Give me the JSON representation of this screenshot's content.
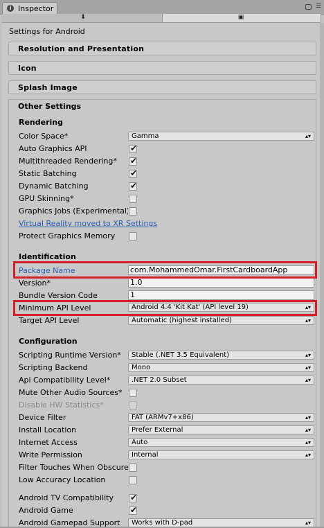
{
  "window": {
    "tab_label": "Inspector",
    "tab_icon": "info-icon"
  },
  "platform_tabs": {
    "icons": [
      "download-icon",
      "android-icon"
    ],
    "selected": "android-icon"
  },
  "subtitle": "Settings for Android",
  "sections": {
    "resolution": "Resolution and Presentation",
    "icon": "Icon",
    "splash": "Splash Image",
    "other": "Other Settings"
  },
  "rendering": {
    "header": "Rendering",
    "color_space": {
      "label": "Color Space*",
      "value": "Gamma"
    },
    "auto_graphics_api": {
      "label": "Auto Graphics API",
      "checked": true
    },
    "multithreaded": {
      "label": "Multithreaded Rendering*",
      "checked": true
    },
    "static_batching": {
      "label": "Static Batching",
      "checked": true
    },
    "dynamic_batching": {
      "label": "Dynamic Batching",
      "checked": true
    },
    "gpu_skinning": {
      "label": "GPU Skinning*",
      "checked": false
    },
    "graphics_jobs": {
      "label": "Graphics Jobs (Experimental)",
      "checked": false
    },
    "vr_link": "Virtual Reality moved to XR Settings",
    "protect_memory": {
      "label": "Protect Graphics Memory",
      "checked": false
    }
  },
  "identification": {
    "header": "Identification",
    "package_name": {
      "label": "Package Name",
      "value": "com.MohammedOmar.FirstCardboardApp"
    },
    "version": {
      "label": "Version*",
      "value": "1.0"
    },
    "bundle_version_code": {
      "label": "Bundle Version Code",
      "value": "1"
    },
    "min_api": {
      "label": "Minimum API Level",
      "value": "Android 4.4 'Kit Kat' (API level 19)"
    },
    "target_api": {
      "label": "Target API Level",
      "value": "Automatic (highest installed)"
    }
  },
  "configuration": {
    "header": "Configuration",
    "scripting_runtime": {
      "label": "Scripting Runtime Version*",
      "value": "Stable (.NET 3.5 Equivalent)"
    },
    "scripting_backend": {
      "label": "Scripting Backend",
      "value": "Mono"
    },
    "api_compat": {
      "label": "Api Compatibility Level*",
      "value": ".NET 2.0 Subset"
    },
    "mute_audio": {
      "label": "Mute Other Audio Sources*",
      "checked": false
    },
    "disable_hw_stats": {
      "label": "Disable HW Statistics*",
      "checked": false
    },
    "device_filter": {
      "label": "Device Filter",
      "value": "FAT (ARMv7+x86)"
    },
    "install_location": {
      "label": "Install Location",
      "value": "Prefer External"
    },
    "internet_access": {
      "label": "Internet Access",
      "value": "Auto"
    },
    "write_permission": {
      "label": "Write Permission",
      "value": "Internal"
    },
    "filter_touches": {
      "label": "Filter Touches When Obscured",
      "checked": false
    },
    "low_accuracy": {
      "label": "Low Accuracy Location",
      "checked": false
    },
    "android_tv": {
      "label": "Android TV Compatibility",
      "checked": true
    },
    "android_game": {
      "label": "Android Game",
      "checked": true
    },
    "gamepad_support": {
      "label": "Android Gamepad Support",
      "value": "Works with D-pad"
    }
  },
  "colors": {
    "highlight": "#d41f2a",
    "link": "#2b5fb4"
  }
}
